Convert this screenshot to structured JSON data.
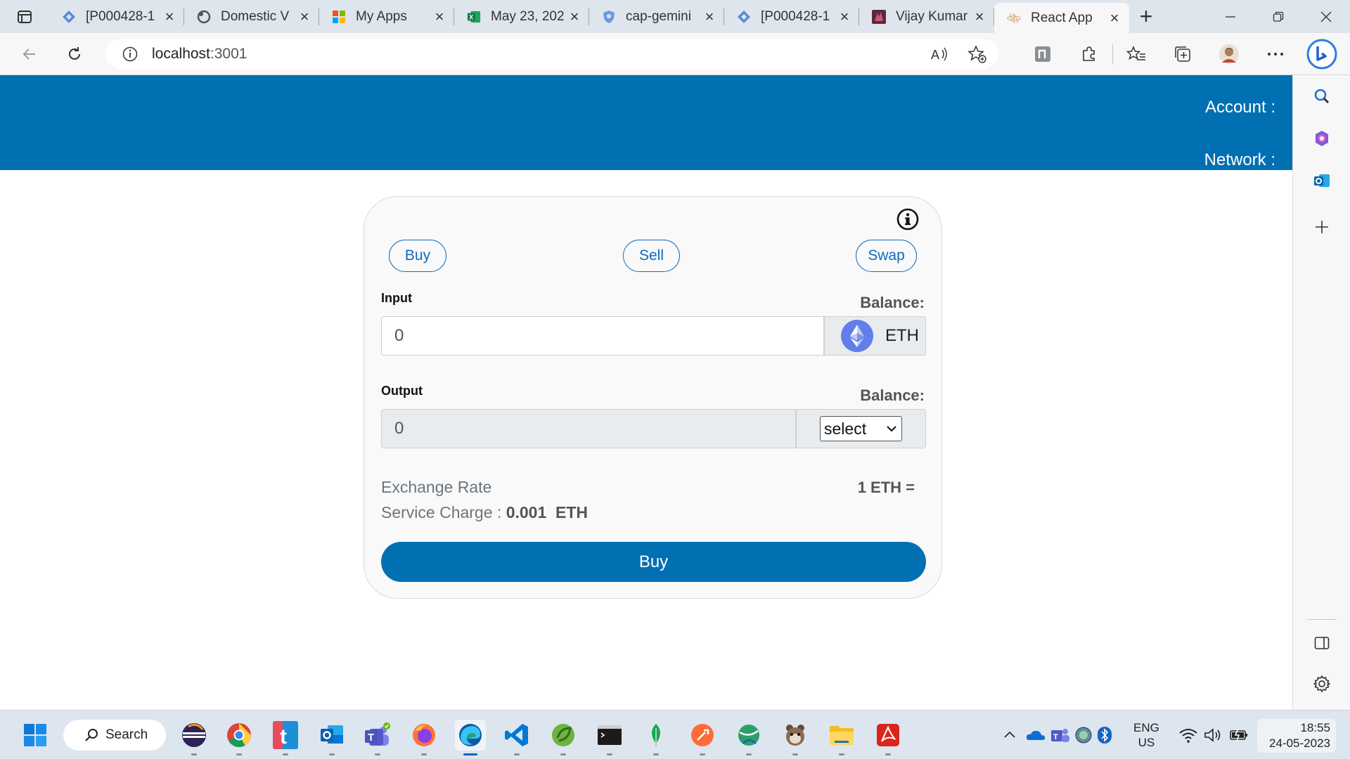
{
  "browser": {
    "tabs": [
      {
        "title": "[P000428-1",
        "icon": "jira-icon",
        "active": false
      },
      {
        "title": "Domestic V",
        "icon": "github-icon",
        "active": false
      },
      {
        "title": "My Apps",
        "icon": "microsoft-icon",
        "active": false
      },
      {
        "title": "May 23, 202",
        "icon": "excel-icon",
        "active": false
      },
      {
        "title": "cap-gemini",
        "icon": "shield-icon",
        "active": false
      },
      {
        "title": "[P000428-1",
        "icon": "jira-icon",
        "active": false
      },
      {
        "title": "Vijay Kumar",
        "icon": "profile-icon",
        "active": false
      },
      {
        "title": "React App",
        "icon": "react-icon",
        "active": true
      }
    ],
    "url_host": "localhost",
    "url_port": ":3001"
  },
  "header": {
    "account_label": "Account :",
    "network_label": "Network :",
    "color": "#0070b2"
  },
  "card": {
    "tabs": {
      "buy": "Buy",
      "sell": "Sell",
      "swap": "Swap"
    },
    "input": {
      "label": "Input",
      "balance_label": "Balance:",
      "value": "0",
      "token": "ETH"
    },
    "output": {
      "label": "Output",
      "balance_label": "Balance:",
      "value": "0",
      "select_value": "select"
    },
    "exchange_rate_label": "Exchange Rate",
    "exchange_rate_value": "1 ETH =",
    "service_charge_label": "Service Charge :",
    "service_charge_value": "0.001",
    "service_charge_unit": "ETH",
    "action_button": "Buy"
  },
  "taskbar": {
    "search_label": "Search",
    "lang_line1": "ENG",
    "lang_line2": "US",
    "time": "18:55",
    "date": "24-05-2023"
  }
}
